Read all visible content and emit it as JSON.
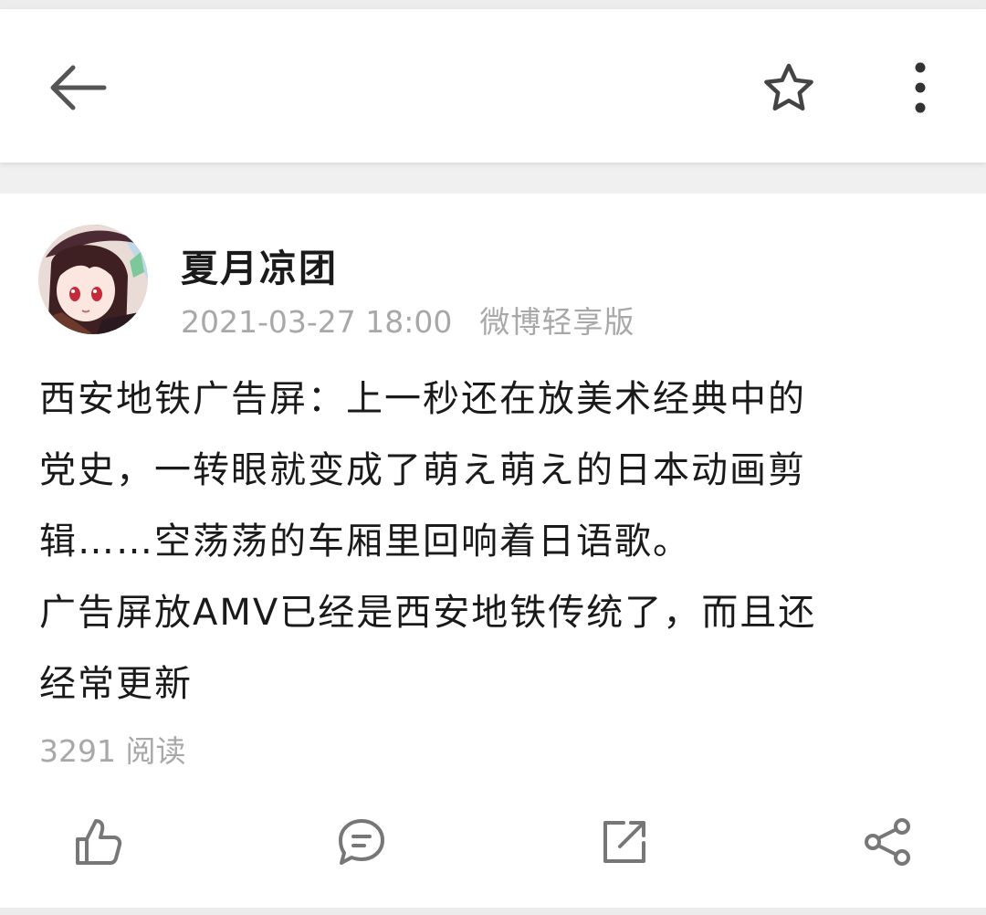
{
  "header": {
    "back_icon": "arrow-left-icon",
    "favorite_icon": "star-outline-icon",
    "more_icon": "more-vertical-icon"
  },
  "post": {
    "author": "夏月凉团",
    "timestamp": "2021-03-27 18:00",
    "source": "微博轻享版",
    "lines": [
      "西安地铁广告屏：上一秒还在放美术经典中的",
      "党史，一转眼就变成了萌え萌え的日本动画剪",
      "辑……空荡荡的车厢里回响着日语歌。",
      "广告屏放AMV已经是西安地铁传统了，而且还",
      "经常更新"
    ],
    "reads": "3291 阅读"
  },
  "actions": [
    {
      "name": "like",
      "icon": "thumbs-up-icon"
    },
    {
      "name": "comment",
      "icon": "comment-bubble-icon"
    },
    {
      "name": "repost",
      "icon": "repost-edit-icon"
    },
    {
      "name": "share",
      "icon": "share-icon"
    }
  ],
  "colors": {
    "text": "#1a1a1a",
    "meta": "#a8a8a8",
    "icon": "#555555",
    "background": "#f0f0f0"
  }
}
